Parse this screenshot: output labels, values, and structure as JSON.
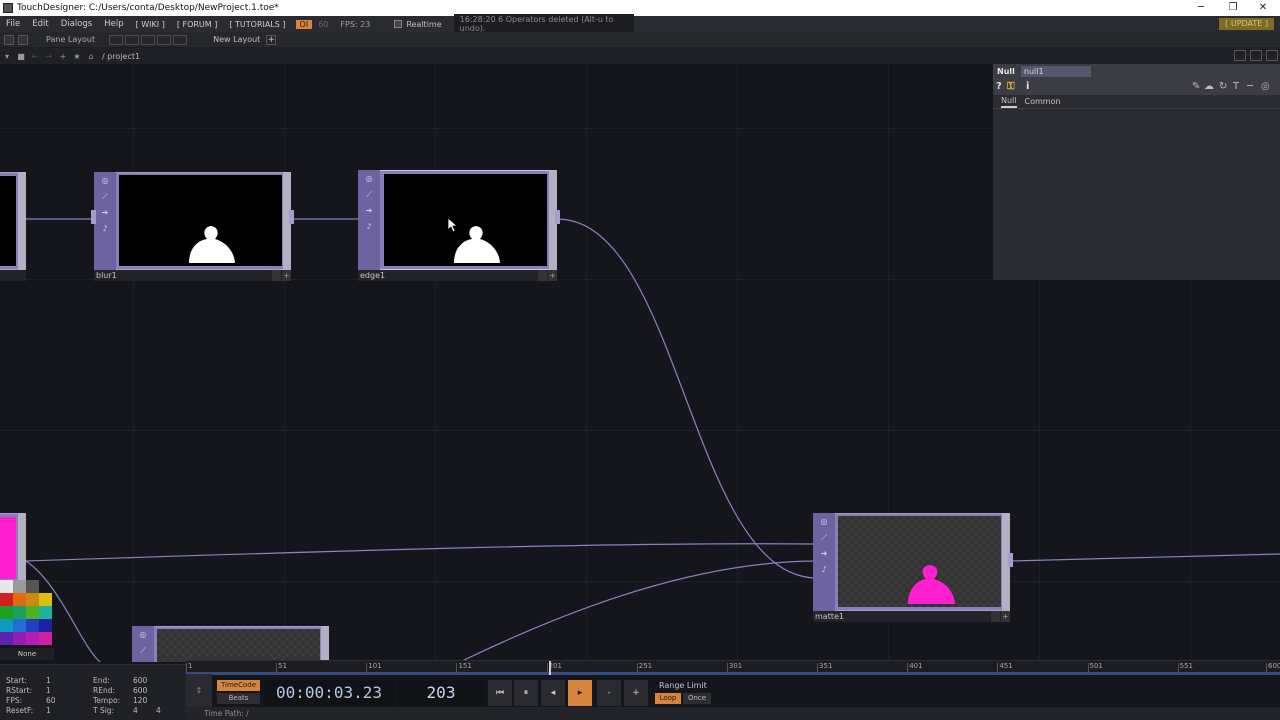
{
  "window": {
    "title": "TouchDesigner: C:/Users/conta/Desktop/NewProject.1.toe*",
    "minimize": "─",
    "restore": "❐",
    "close": "✕"
  },
  "menubar": {
    "file": "File",
    "edit": "Edit",
    "dialogs": "Dialogs",
    "help": "Help",
    "wiki": "[ WIKI ]",
    "forum": "[ FORUM ]",
    "tutorials": "[ TUTORIALS ]",
    "oi": "OI",
    "sixty": "60",
    "fps": "FPS: 23",
    "realtime": "Realtime",
    "message": "16:28:20 6 Operators deleted (Alt-u to undo).",
    "update": "[ UPDATE ]"
  },
  "panebar": {
    "label": "Pane Layout",
    "new_layout": "New Layout",
    "plus": "+"
  },
  "pathbar": {
    "path": "/ project1"
  },
  "nodes": {
    "blur": {
      "name": "blur1"
    },
    "edge": {
      "name": "edge1"
    },
    "matte": {
      "name": "matte1"
    }
  },
  "params": {
    "type": "Null",
    "name": "null1",
    "help_icon": "?",
    "info_icon": "i",
    "tabs": [
      "Null",
      "Common"
    ]
  },
  "timeline": {
    "ticks": [
      "1",
      "51",
      "101",
      "151",
      "201",
      "251",
      "301",
      "351",
      "401",
      "451",
      "501",
      "551",
      "600"
    ],
    "current_frame_fraction": 0.336
  },
  "range": {
    "start_label": "Start:",
    "start": "1",
    "end_label": "End:",
    "end": "600",
    "rstart_label": "RStart:",
    "rstart": "1",
    "rend_label": "REnd:",
    "rend": "600",
    "fps_label": "FPS:",
    "fps": "60",
    "tempo_label": "Tempo:",
    "tempo": "120",
    "resetf_label": "ResetF:",
    "resetf": "1",
    "tsig_label": "T Sig:",
    "tsig_a": "4",
    "tsig_b": "4"
  },
  "transport": {
    "timecode_label": "TimeCode",
    "beats_label": "Beats",
    "timecode": "00:00:03.23",
    "frame": "203",
    "rewind": "⏮",
    "stop": "⏸",
    "step_back": "◂",
    "play": "▸",
    "minus": "-",
    "plus": "+",
    "range_limit": "Range Limit",
    "loop": "Loop",
    "once": "Once",
    "time_path": "Time Path: /"
  },
  "palette": {
    "none_label": "None"
  },
  "colors": {
    "accent_orange": "#d9843c",
    "node_purple": "#8b7fb8",
    "matte_pink": "#ff1fcf",
    "wire": "#8a80c2"
  }
}
